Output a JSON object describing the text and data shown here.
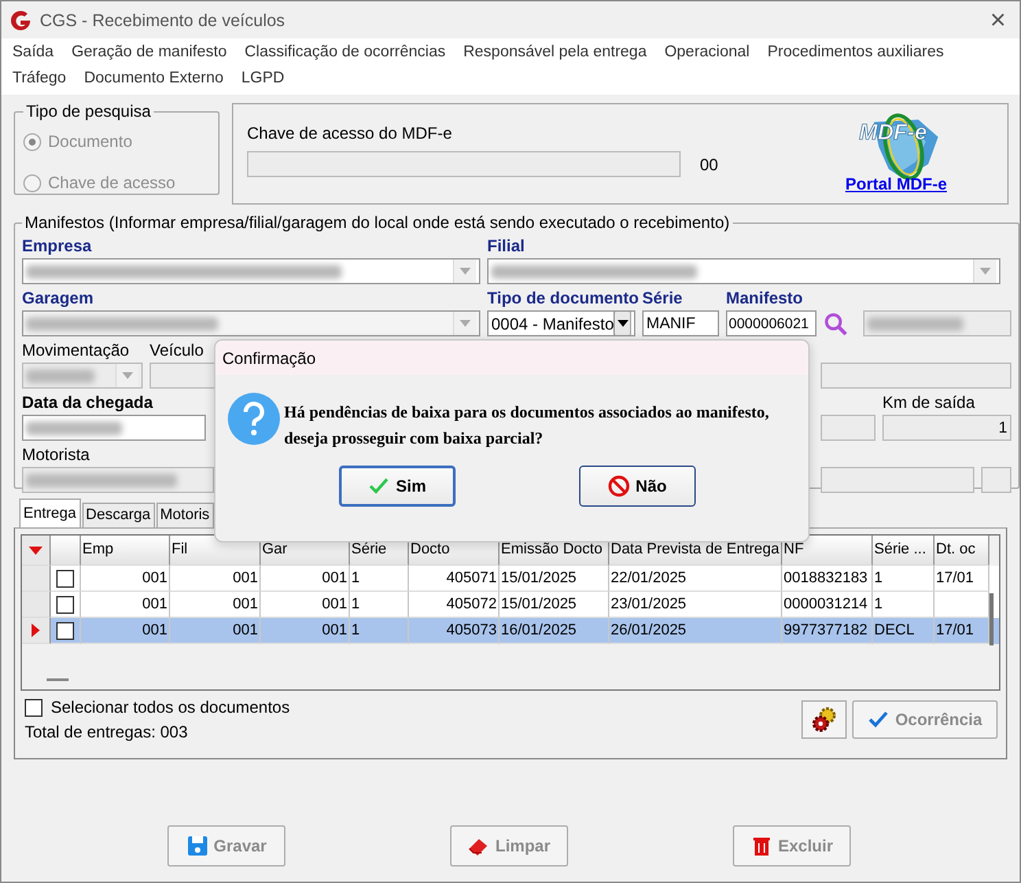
{
  "window": {
    "title": "CGS - Recebimento de veículos",
    "close": "×"
  },
  "menu": [
    "Saída",
    "Geração de manifesto",
    "Classificação de ocorrências",
    "Responsável pela entrega",
    "Operacional",
    "Procedimentos auxiliares",
    "Tráfego",
    "Documento Externo",
    "LGPD"
  ],
  "search_type": {
    "title": "Tipo de pesquisa",
    "options": [
      {
        "label": "Documento",
        "selected": true,
        "disabled": true
      },
      {
        "label": "Chave de acesso",
        "selected": false,
        "disabled": true
      }
    ]
  },
  "access_key": {
    "label": "Chave de acesso do MDF-e",
    "digits": "00",
    "logo_text": "MDF-e",
    "link": "Portal MDF-e"
  },
  "manifestos": {
    "title": "Manifestos (Informar empresa/filial/garagem do local onde está sendo executado o recebimento)",
    "empresa": "Empresa",
    "filial": "Filial",
    "garagem": "Garagem",
    "tipo_documento": {
      "label": "Tipo de documento",
      "value": "0004 - Manifesto"
    },
    "serie": {
      "label": "Série",
      "value": "MANIF"
    },
    "manifesto": {
      "label": "Manifesto",
      "value": "0000006021"
    },
    "movimentacao": "Movimentação",
    "veiculo": "Veículo",
    "data_chegada": "Data da chegada",
    "km_saida": {
      "label": "Km de saída",
      "value": "1"
    },
    "motorista": "Motorista"
  },
  "tabs": [
    {
      "label": "Entrega",
      "selected": true
    },
    {
      "label": "Descarga",
      "selected": false
    },
    {
      "label": "Motoris",
      "selected": false
    }
  ],
  "table": {
    "columns": [
      "Emp",
      "Fil",
      "Gar",
      "Série",
      "Docto",
      "Emissão Docto",
      "Data Prevista de Entrega",
      "NF",
      "Série ...",
      "Dt. oc"
    ],
    "rows": [
      {
        "checked": false,
        "selected": false,
        "cells": [
          "001",
          "001",
          "001",
          "1",
          "405071",
          "15/01/2025",
          "22/01/2025",
          "0018832183",
          "1",
          "17/01"
        ]
      },
      {
        "checked": false,
        "selected": false,
        "cells": [
          "001",
          "001",
          "001",
          "1",
          "405072",
          "15/01/2025",
          "23/01/2025",
          "0000031214",
          "1",
          ""
        ]
      },
      {
        "checked": false,
        "selected": true,
        "cells": [
          "001",
          "001",
          "001",
          "1",
          "405073",
          "16/01/2025",
          "26/01/2025",
          "9977377182",
          "DECL",
          "17/01"
        ]
      }
    ]
  },
  "select_all": {
    "label": "Selecionar todos os documentos",
    "checked": false
  },
  "total": "Total de entregas: 003",
  "occurrence_button": {
    "label": "Ocorrência",
    "disabled": true
  },
  "buttons": [
    {
      "kind": "save",
      "label": "Gravar",
      "disabled": true
    },
    {
      "kind": "clear",
      "label": "Limpar",
      "disabled": true
    },
    {
      "kind": "delete",
      "label": "Excluir",
      "disabled": true
    }
  ],
  "dialog": {
    "title": "Confirmação",
    "message": "Há pendências de baixa para os documentos associados ao manifesto, deseja prosseguir com baixa parcial?",
    "buttons": [
      {
        "kind": "yes",
        "label": "Sim",
        "selected": true
      },
      {
        "kind": "no",
        "label": "Não",
        "selected": false
      }
    ]
  }
}
